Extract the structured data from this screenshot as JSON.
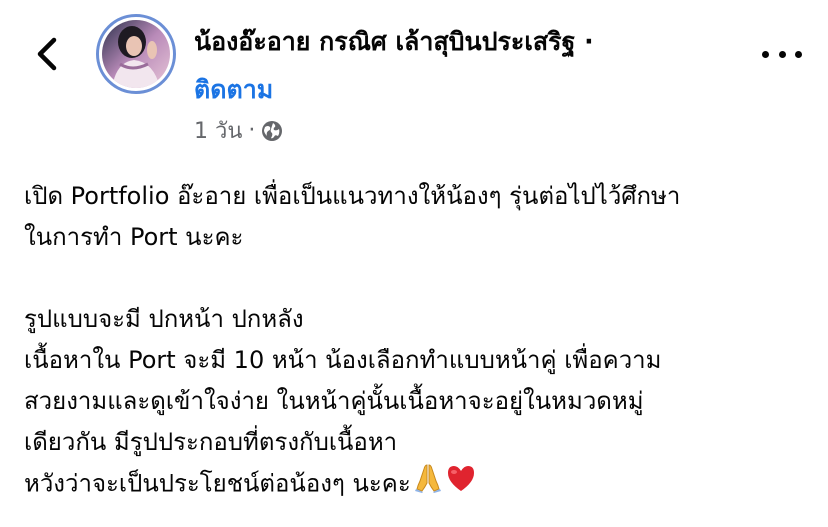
{
  "post": {
    "author": "น้องอ๊ะอาย กรณิศ เล้าสุบินประเสริฐ ·",
    "follow_label": "ติดตาม",
    "timestamp": "1 วัน",
    "dot": "·",
    "audience_icon": "globe-icon",
    "lines": {
      "l1": "เปิด Portfolio อ๊ะอาย เพื่อเป็นแนวทางให้น้องๆ รุ่นต่อไปไว้ศึกษา",
      "l2": "ในการทำ Port  นะคะ",
      "l3": "รูปแบบจะมี ปกหน้า ปกหลัง",
      "l4": "เนื้อหาใน Port จะมี 10 หน้า น้องเลือกทำแบบหน้าคู่ เพื่อความ",
      "l5": "สวยงามและดูเข้าใจง่าย ในหน้าคู่นั้นเนื้อหาจะอยู่ในหมวดหมู่",
      "l6": "เดียวกัน มีรูปประกอบที่ตรงกับเนื้อหา",
      "l7": "หวังว่าจะเป็นประโยชน์ต่อน้องๆ นะคะ"
    },
    "emojis": [
      "folded-hands-icon",
      "red-heart-icon"
    ]
  },
  "colors": {
    "link": "#1b74e4",
    "meta": "#65676b",
    "text": "#050505",
    "avatar_ring": "#6b8fd6"
  }
}
